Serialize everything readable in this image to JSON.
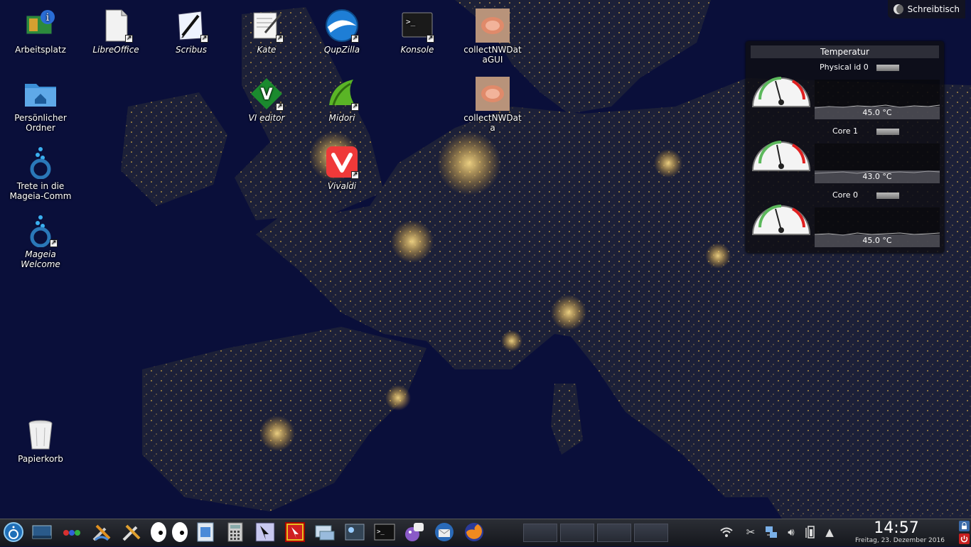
{
  "colors": {
    "accent": "#3a9ad9",
    "wallpaper_sea": "#0a0f3a",
    "city_lights": "#ffcc55",
    "gauge_red": "#e02020",
    "gauge_green": "#5cb85c"
  },
  "desktop": {
    "icons": [
      {
        "name": "arbeitsplatz",
        "label": "Arbeitsplatz",
        "icon": "computer-icon",
        "link": false
      },
      {
        "name": "libreoffice",
        "label": "LibreOffice",
        "icon": "libreoffice-icon",
        "link": true
      },
      {
        "name": "scribus",
        "label": "Scribus",
        "icon": "scribus-icon",
        "link": true
      },
      {
        "name": "kate",
        "label": "Kate",
        "icon": "kate-icon",
        "link": true
      },
      {
        "name": "qupzilla",
        "label": "QupZilla",
        "icon": "qupzilla-icon",
        "link": true
      },
      {
        "name": "konsole",
        "label": "Konsole",
        "icon": "terminal-icon",
        "link": true
      },
      {
        "name": "collectnwdatagui",
        "label": "collectNWDataGUI",
        "icon": "collectnwdata-icon",
        "link": false
      },
      {
        "name": "persoenlicher-ordner",
        "label": "Persönlicher Ordner",
        "icon": "home-folder-icon",
        "link": false
      },
      {
        "name": "vi-editor",
        "label": "VI editor",
        "icon": "vim-icon",
        "link": true
      },
      {
        "name": "midori",
        "label": "Midori",
        "icon": "midori-icon",
        "link": true
      },
      {
        "name": "collectnwdata",
        "label": "collectNWData",
        "icon": "collectnwdata-icon",
        "link": false
      },
      {
        "name": "mageia-community",
        "label": "Trete in die Mageia-Comm",
        "icon": "mageia-icon",
        "link": false
      },
      {
        "name": "vivaldi",
        "label": "Vivaldi",
        "icon": "vivaldi-icon",
        "link": true
      },
      {
        "name": "mageia-welcome",
        "label": "Mageia Welcome",
        "icon": "mageia-icon",
        "link": true
      },
      {
        "name": "papierkorb",
        "label": "Papierkorb",
        "icon": "trash-icon",
        "link": false
      }
    ],
    "toolbox_label": "Schreibtisch"
  },
  "temperature_widget": {
    "title": "Temperatur",
    "sensors": [
      {
        "name": "Physical id 0",
        "value": "45.0 °C"
      },
      {
        "name": "Core 1",
        "value": "43.0 °C"
      },
      {
        "name": "Core 0",
        "value": "45.0 °C"
      }
    ]
  },
  "taskbar": {
    "launchers": [
      "mageia-menu-icon",
      "show-desktop-icon",
      "activities-icon",
      "system-settings-icon",
      "tools-icon",
      "eyes-icon",
      "file-manager-icon",
      "calculator-icon",
      "screenshot-icon",
      "select-tool-icon",
      "network-icon",
      "video-icon",
      "terminal-icon",
      "pidgin-icon",
      "thunderbird-icon",
      "firefox-icon"
    ],
    "pager_desktops": 4,
    "tray_icons": [
      "wifi-icon",
      "scissors-icon",
      "network-icon",
      "volume-icon",
      "battery-icon",
      "expand-tray-icon"
    ],
    "clock_time": "14:57",
    "clock_date": "Freitag, 23. Dezember 2016"
  }
}
